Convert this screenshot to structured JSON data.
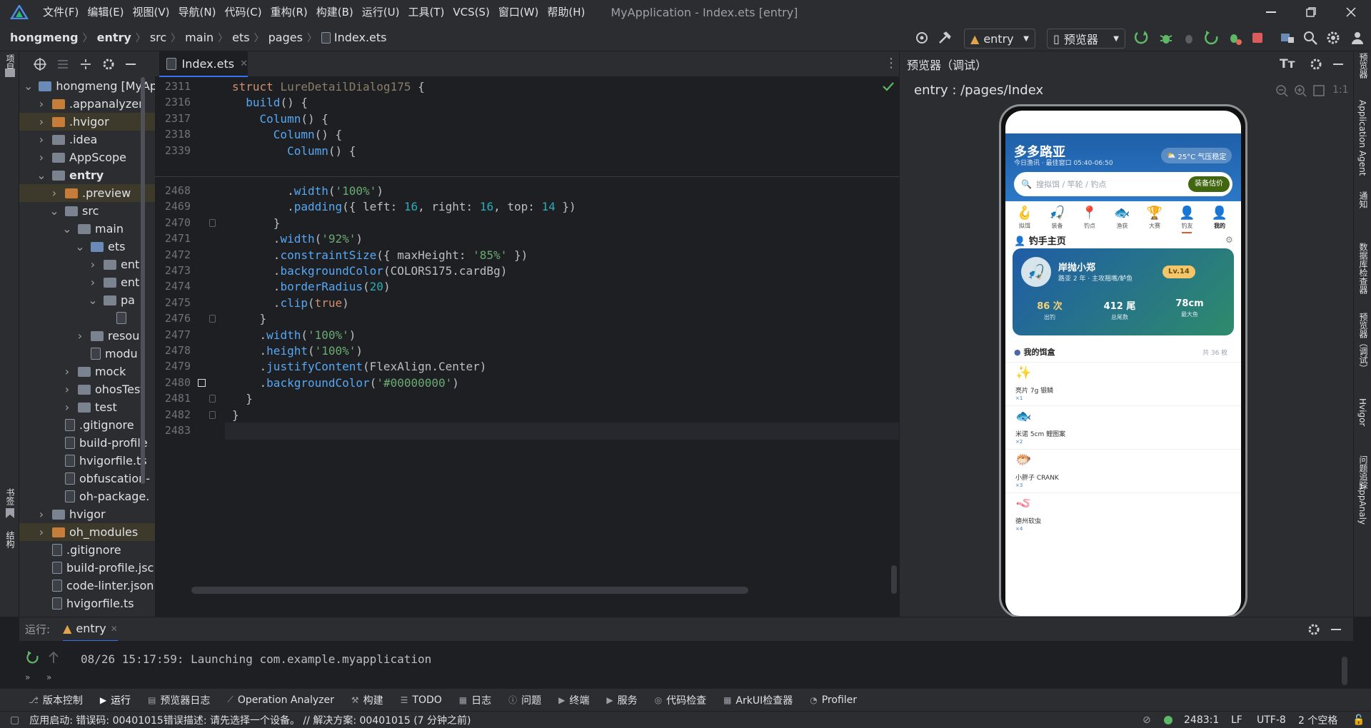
{
  "menubar": {
    "items": [
      "文件(F)",
      "编辑(E)",
      "视图(V)",
      "导航(N)",
      "代码(C)",
      "重构(R)",
      "构建(B)",
      "运行(U)",
      "工具(T)",
      "VCS(S)",
      "窗口(W)",
      "帮助(H)"
    ],
    "window_title": "MyApplication - Index.ets [entry]"
  },
  "breadcrumb": [
    "hongmeng",
    "entry",
    "src",
    "main",
    "ets",
    "pages",
    "Index.ets"
  ],
  "toolbar": {
    "config": "entry",
    "device": "预览器"
  },
  "project": {
    "rows": [
      {
        "label": "hongmeng [MyAp",
        "depth": 0,
        "type": "folder-b",
        "chev": "v"
      },
      {
        "label": ".appanalyzer",
        "depth": 1,
        "type": "folder-o",
        "chev": ">"
      },
      {
        "label": ".hvigor",
        "depth": 1,
        "type": "folder-o",
        "chev": ">"
      },
      {
        "label": ".idea",
        "depth": 1,
        "type": "folder-g",
        "chev": ">"
      },
      {
        "label": "AppScope",
        "depth": 1,
        "type": "folder-g",
        "chev": ">"
      },
      {
        "label": "entry",
        "depth": 1,
        "type": "folder-g",
        "chev": "v",
        "bold": true
      },
      {
        "label": ".preview",
        "depth": 2,
        "type": "folder-o",
        "chev": ">"
      },
      {
        "label": "src",
        "depth": 2,
        "type": "folder-g",
        "chev": "v"
      },
      {
        "label": "main",
        "depth": 3,
        "type": "folder-g",
        "chev": "v"
      },
      {
        "label": "ets",
        "depth": 4,
        "type": "folder-b",
        "chev": "v"
      },
      {
        "label": "ent",
        "depth": 5,
        "type": "folder-g",
        "chev": ">"
      },
      {
        "label": "ent",
        "depth": 5,
        "type": "folder-g",
        "chev": ">"
      },
      {
        "label": "pa",
        "depth": 5,
        "type": "folder-g",
        "chev": "v"
      },
      {
        "label": "",
        "depth": 6,
        "type": "file",
        "chev": ""
      },
      {
        "label": "resou",
        "depth": 4,
        "type": "folder-g",
        "chev": ">"
      },
      {
        "label": "modu",
        "depth": 4,
        "type": "file",
        "chev": ""
      },
      {
        "label": "mock",
        "depth": 3,
        "type": "folder-g",
        "chev": ">"
      },
      {
        "label": "ohosTest",
        "depth": 3,
        "type": "folder-g",
        "chev": ">"
      },
      {
        "label": "test",
        "depth": 3,
        "type": "folder-g",
        "chev": ">"
      },
      {
        "label": ".gitignore",
        "depth": 2,
        "type": "file",
        "chev": ""
      },
      {
        "label": "build-profile",
        "depth": 2,
        "type": "file",
        "chev": ""
      },
      {
        "label": "hvigorfile.ts",
        "depth": 2,
        "type": "file",
        "chev": ""
      },
      {
        "label": "obfuscation-",
        "depth": 2,
        "type": "file",
        "chev": ""
      },
      {
        "label": "oh-package.",
        "depth": 2,
        "type": "file",
        "chev": ""
      },
      {
        "label": "hvigor",
        "depth": 1,
        "type": "folder-g",
        "chev": ">"
      },
      {
        "label": "oh_modules",
        "depth": 1,
        "type": "folder-o",
        "chev": ">"
      },
      {
        "label": ".gitignore",
        "depth": 1,
        "type": "file",
        "chev": ""
      },
      {
        "label": "build-profile.jsc",
        "depth": 1,
        "type": "file",
        "chev": ""
      },
      {
        "label": "code-linter.json",
        "depth": 1,
        "type": "file",
        "chev": ""
      },
      {
        "label": "hvigorfile.ts",
        "depth": 1,
        "type": "file",
        "chev": ""
      }
    ]
  },
  "editor": {
    "tab": "Index.ets",
    "sticky": [
      {
        "ln": "2311",
        "html": "<span class='kw'>struct</span> <span class='cls'>LureDetailDialog175</span> {"
      },
      {
        "ln": "2316",
        "html": "  <span class='fn'>build</span>() {"
      },
      {
        "ln": "2317",
        "html": "    <span class='fn'>Column</span>() {"
      },
      {
        "ln": "2318",
        "html": "      <span class='fn'>Column</span>() {"
      },
      {
        "ln": "2339",
        "html": "        <span class='fn'>Column</span>() {"
      }
    ],
    "lines": [
      {
        "ln": "2468",
        "html": "        .<span class='fn'>width</span>(<span class='str'>'100%'</span>)"
      },
      {
        "ln": "2469",
        "html": "        .<span class='fn'>padding</span>({ left: <span class='num'>16</span>, right: <span class='num'>16</span>, top: <span class='num'>14</span> })"
      },
      {
        "ln": "2470",
        "html": "      }"
      },
      {
        "ln": "2471",
        "html": "      .<span class='fn'>width</span>(<span class='str'>'92%'</span>)"
      },
      {
        "ln": "2472",
        "html": "      .<span class='fn'>constraintSize</span>({ maxHeight: <span class='str'>'85%'</span> })"
      },
      {
        "ln": "2473",
        "html": "      .<span class='fn'>backgroundColor</span>(COLORS175.cardBg)"
      },
      {
        "ln": "2474",
        "html": "      .<span class='fn'>borderRadius</span>(<span class='num'>20</span>)"
      },
      {
        "ln": "2475",
        "html": "      .<span class='fn'>clip</span>(<span class='kw'>true</span>)"
      },
      {
        "ln": "2476",
        "html": "    }"
      },
      {
        "ln": "2477",
        "html": "    .<span class='fn'>width</span>(<span class='str'>'100%'</span>)"
      },
      {
        "ln": "2478",
        "html": "    .<span class='fn'>height</span>(<span class='str'>'100%'</span>)"
      },
      {
        "ln": "2479",
        "html": "    .<span class='fn'>justifyContent</span>(FlexAlign.Center)"
      },
      {
        "ln": "2480",
        "html": "    .<span class='fn'>backgroundColor</span>(<span class='str'>'#00000000'</span>)"
      },
      {
        "ln": "2481",
        "html": "  }"
      },
      {
        "ln": "2482",
        "html": "}"
      },
      {
        "ln": "2483",
        "html": ""
      }
    ]
  },
  "preview": {
    "header": "预览器（调试）",
    "path": "entry : /pages/Index",
    "app": {
      "title": "多多路亚",
      "subtitle": "今日渔讯 · 最佳窗口 05:40-06:50",
      "weather": "25°C 气压稳定",
      "search_placeholder": "搜拟饵 / 竿轮 / 钓点",
      "estimate_button": "装备估价",
      "categories": [
        {
          "icon": "🪝",
          "label": "拟饵"
        },
        {
          "icon": "🎣",
          "label": "装备"
        },
        {
          "icon": "📍",
          "label": "钓点"
        },
        {
          "icon": "🐟",
          "label": "渔获"
        },
        {
          "icon": "🏆",
          "label": "大赛"
        },
        {
          "icon": "👤",
          "label": "钓友"
        },
        {
          "icon": "👤",
          "label": "我的"
        }
      ],
      "profile_section": "钓手主页",
      "profile": {
        "name": "岸抛小郑",
        "desc": "路亚 2 年 · 主攻翘嘴/鲈鱼",
        "level": "Lv.14",
        "stats": [
          {
            "value": "86 次",
            "label": "出钓"
          },
          {
            "value": "412 尾",
            "label": "总尾数"
          },
          {
            "value": "78cm",
            "label": "最大鱼"
          }
        ]
      },
      "bait_section": "我的饵盒",
      "bait_count": "共 36 枚",
      "baits": [
        {
          "icon": "✨",
          "name": "亮片 7g 银鳞",
          "qty": "×1"
        },
        {
          "icon": "🐟",
          "name": "米诺 5cm 鲤图案",
          "qty": "×2"
        },
        {
          "icon": "🐡",
          "name": "小胖子 CRANK",
          "qty": "×3"
        },
        {
          "icon": "🪱",
          "name": "德州软虫",
          "qty": "×4"
        }
      ]
    }
  },
  "run": {
    "label": "运行:",
    "tab": "entry",
    "log": "08/26 15:17:59: Launching com.example.myapplication"
  },
  "tools": [
    "版本控制",
    "运行",
    "预览器日志",
    "Operation Analyzer",
    "构建",
    "TODO",
    "日志",
    "问题",
    "终端",
    "服务",
    "代码检查",
    "ArkUI检查器",
    "Profiler"
  ],
  "status": {
    "message": "应用启动: 错误码: 00401015错误描述: 请先选择一个设备。 // 解决方案: 00401015 (7 分钟之前)",
    "position": "2483:1",
    "line_sep": "LF",
    "encoding": "UTF-8",
    "indent": "2 个空格"
  },
  "side_labels": {
    "left_top": "项目",
    "left_bottom1": "书签",
    "left_bottom2": "结构",
    "right": [
      "预览器",
      "Application Agent",
      "通知",
      "数据库检查器",
      "预览器（调试）",
      "Hvigor",
      "问题追踪",
      "AppAnaly"
    ]
  }
}
